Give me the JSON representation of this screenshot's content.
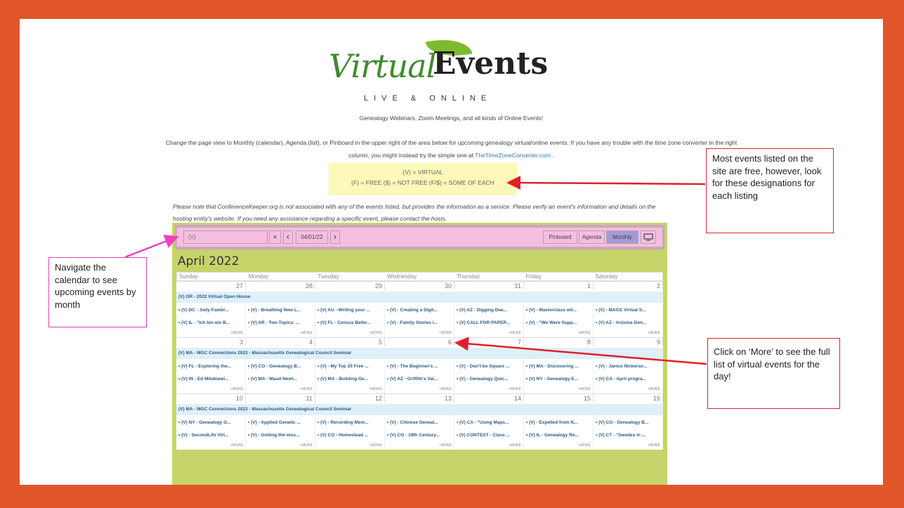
{
  "logo": {
    "virtual": "Virtual",
    "events": "Events",
    "tagline": "LIVE & ONLINE"
  },
  "intro": {
    "p1": "Genealogy Webinars, Zoom Meetings, and all kinds of Online Events!",
    "p2": "Change the page view to Monthly (calendar), Agenda (list), or Pinboard in the upper right of the area below for upcoming genealogy virtual/online events.   If you have any trouble with the time zone converter in the right column, you might instead try the simple one at",
    "link": "TheTimeZoneConverter.com",
    "p2_end": "."
  },
  "legend": {
    "line1": "(V) = VIRTUAL",
    "line2": "(F) = FREE   ($) = NOT FREE   (F/$) = SOME OF EACH"
  },
  "note": "Please note that ConferenceKeeper.org is not associated with any of the events listed, but provides the information as a service. Please verify an event's information and details on the hosting entity's website. If you need any assistance regarding a specific event, please contact the hosts.",
  "toolbar": {
    "search_value": "(V)",
    "clear": "✕",
    "prev": "‹",
    "date": "04/01/22",
    "next": "›",
    "views": [
      "Pinboard",
      "Agenda",
      "Monthly"
    ],
    "active_view": "Monthly",
    "screen_icon": "display-icon"
  },
  "calendar": {
    "month_title": "April 2022",
    "days_of_week": [
      "Sunday",
      "Monday",
      "Tuesday",
      "Wednesday",
      "Thursday",
      "Friday",
      "Saturday"
    ],
    "more_label": "+MORE",
    "weeks": [
      {
        "days": [
          "27",
          "28",
          "29",
          "30",
          "31",
          "1",
          "2"
        ],
        "banner": "(V) OR - 2022 Virtual Open House",
        "rows": [
          [
            "• (V) DC - Judy-Fambr...",
            "• (V) - Breathing New L...",
            "• (V) AU - Writing your ...",
            "• (V) - Creating a Digit...",
            "• (V) AZ - Digging Dee...",
            "• (V) - Masterclass wit...",
            "• (V) - MAGS Virtual S..."
          ],
          [
            "• (V) IL - \"Ich bin ein B...",
            "• (V) AR - Two Topics: ...",
            "• (V) FL - Census Befor...",
            "• (V) - Family Stories i...",
            "• (V) CALL FOR PAPER...",
            "• (V) - \"We Were Supp...",
            "• (V) AZ - Arizona Gen..."
          ]
        ]
      },
      {
        "days": [
          "3",
          "4",
          "5",
          "6",
          "7",
          "8",
          "9"
        ],
        "banner": "(V) MA - MGC Connections 2022 - Massachusetts Genealogical Council Seminar",
        "rows": [
          [
            "• (V) FL - Exploring the...",
            "• (V) CO - Genealogy B...",
            "• (V) - My Top 20 Free ...",
            "• (V) - The Beginner's ...",
            "• (V) - Don't be Square ...",
            "• (V) MA - Discovering ...",
            "• (V) - Janice Nickerso..."
          ],
          [
            "• (V) IN - Ed Mitukiewi...",
            "• (V) MA - Maud Newt...",
            "• (V) MA - Building Ge...",
            "• (V) AZ - Griffith's Val...",
            "• (V) - Genealogy Quic...",
            "• (V) NY - Genealogy E...",
            "• (V) CA - April progra..."
          ]
        ]
      },
      {
        "days": [
          "10",
          "11",
          "12",
          "13",
          "14",
          "15",
          "16"
        ],
        "banner": "(V) MA - MGC Connections 2022 - Massachusetts Genealogical Council Seminar",
        "rows": [
          [
            "• (V) NY - Genealogy G...",
            "• (V) - Applied Genetic ...",
            "• (V) - Recording Mem...",
            "• (V) - Chinese Geneal...",
            "• (V) CA - \"Using Maps...",
            "• (V) - Expelled from N...",
            "• (V) CO - Genealogy B..."
          ],
          [
            "• (V) - SecondLife Virt...",
            "• (V) - Getting the mos...",
            "• (V) CO - Homestead ...",
            "• (V) CO - 19th Century...",
            "• (V) CONTEST - Class ...",
            "• (V) IL - Genealogy Re...",
            "• (V) CT - \"Swedes in ..."
          ]
        ]
      }
    ]
  },
  "callouts": {
    "designations": "Most events listed on the site are free, however, look for these designations for each listing",
    "navigate": "Navigate the calendar to see upcoming events by month",
    "more": "Click on ‘More’ to see the full list of virtual events for the day!"
  },
  "colors": {
    "frame": "#e0562a",
    "calendar_bg": "#c6d46a",
    "toolbar": "#f5bedf",
    "legend": "#fcf8b8",
    "arrow_red": "#e0202a",
    "arrow_pink": "#f040c0"
  }
}
